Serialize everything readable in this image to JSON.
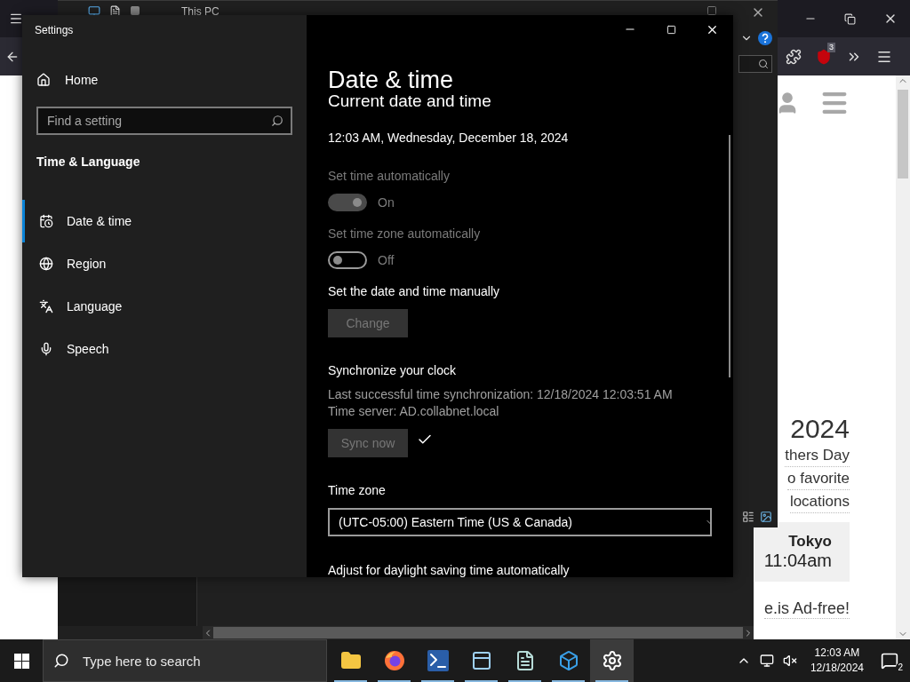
{
  "browser": {
    "extension_badge": "3",
    "page": {
      "headline": "2024",
      "lines": [
        "thers Day",
        "o favorite",
        "locations"
      ],
      "card": {
        "city": "Tokyo",
        "time": "11:04am"
      },
      "footer": "e.is Ad-free!"
    }
  },
  "explorer": {
    "title": "This PC"
  },
  "settings": {
    "title": "Settings",
    "home": "Home",
    "search": {
      "placeholder": "Find a setting"
    },
    "section": "Time & Language",
    "nav": [
      {
        "label": "Date & time",
        "kind": "calendar",
        "selected": true
      },
      {
        "label": "Region",
        "kind": "region",
        "selected": false
      },
      {
        "label": "Language",
        "kind": "language",
        "selected": false
      },
      {
        "label": "Speech",
        "kind": "speech",
        "selected": false
      }
    ],
    "page_title": "Date & time",
    "heading": "Current date and time",
    "current": "12:03 AM, Wednesday, December 18, 2024",
    "toggles": [
      {
        "label": "Set time automatically",
        "on": true,
        "disabled": true,
        "state_text": "On"
      },
      {
        "label": "Set time zone automatically",
        "on": false,
        "disabled": true,
        "state_text": "Off"
      }
    ],
    "manual": {
      "label": "Set the date and time manually",
      "button": "Change",
      "disabled": true
    },
    "sync": {
      "heading": "Synchronize your clock",
      "lines": [
        "Last successful time synchronization: 12/18/2024 12:03:51 AM",
        "Time server: AD.collabnet.local"
      ],
      "button": "Sync now",
      "disabled": true,
      "succeeded": true
    },
    "time_zone": {
      "label": "Time zone",
      "value": "(UTC-05:00) Eastern Time (US & Canada)"
    },
    "daylight_label": "Adjust for daylight saving time automatically"
  },
  "taskbar": {
    "search": {
      "placeholder": "Type here to search"
    },
    "apps": [
      {
        "kind": "folder",
        "selected": false
      },
      {
        "kind": "firefox",
        "selected": false
      },
      {
        "kind": "powershell",
        "selected": false
      },
      {
        "kind": "panel",
        "selected": false
      },
      {
        "kind": "notepad",
        "selected": false
      },
      {
        "kind": "cube",
        "selected": false
      },
      {
        "kind": "settings",
        "selected": true
      }
    ],
    "time": "12:03 AM",
    "date": "12/18/2024",
    "notification_count": "2"
  }
}
